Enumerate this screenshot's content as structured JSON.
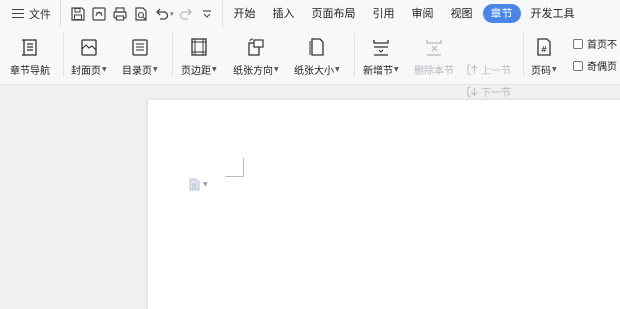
{
  "menubar": {
    "file_label": "文件",
    "tabs": [
      {
        "label": "开始"
      },
      {
        "label": "插入"
      },
      {
        "label": "页面布局"
      },
      {
        "label": "引用"
      },
      {
        "label": "审阅"
      },
      {
        "label": "视图"
      },
      {
        "label": "章节",
        "active": true
      },
      {
        "label": "开发工具"
      }
    ]
  },
  "ribbon": {
    "chapter_nav": "章节导航",
    "cover_page": "封面页",
    "toc_page": "目录页",
    "margins": "页边距",
    "orientation": "纸张方向",
    "paper_size": "纸张大小",
    "new_section": "新增节",
    "delete_section": "删除本节",
    "prev_section": "上一节",
    "next_section": "下一节",
    "page_number": "页码",
    "first_page_diff": "首页不",
    "odd_even_diff": "奇偶页"
  },
  "colors": {
    "accent": "#4a86e8",
    "ribbon_bg": "#f7f8fa",
    "workspace_bg": "#eef0f2"
  }
}
